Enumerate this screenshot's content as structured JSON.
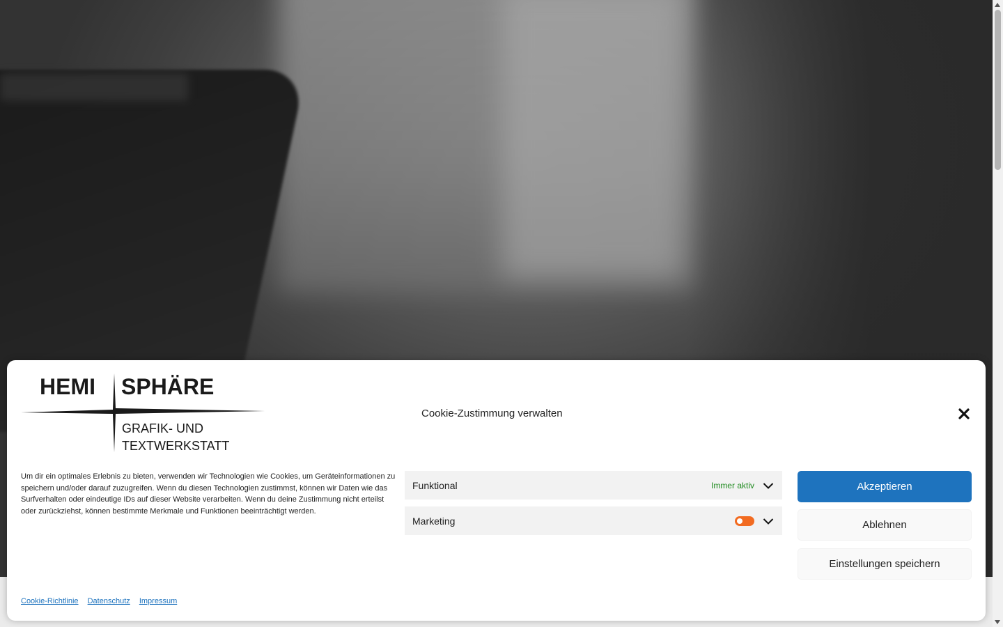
{
  "logo": {
    "line1_left": "HEMI",
    "line1_right": "SPHÄRE",
    "line2": "GRAFIK- UND",
    "line3": "TEXTWERKSTATT"
  },
  "banner": {
    "title": "Cookie-Zustimmung verwalten",
    "close_icon": "close-icon",
    "message": "Um dir ein optimales Erlebnis zu bieten, verwenden wir Technologien wie Cookies, um Geräteinformationen zu speichern und/oder darauf zuzugreifen. Wenn du diesen Technologien zustimmst, können wir Daten wie das Surfverhalten oder eindeutige IDs auf dieser Website verarbeiten. Wenn du deine Zustimmung nicht erteilst oder zurückziehst, können bestimmte Merkmale und Funktionen beeinträchtigt werden.",
    "categories": [
      {
        "name": "Funktional",
        "status": "Immer aktiv"
      },
      {
        "name": "Marketing",
        "toggle": "off"
      }
    ],
    "buttons": {
      "accept": "Akzeptieren",
      "deny": "Ablehnen",
      "save": "Einstellungen speichern"
    },
    "links": [
      "Cookie-Richtlinie",
      "Datenschutz",
      "Impressum"
    ]
  },
  "colors": {
    "accent": "#1e73be",
    "always_active": "#1e8a1e",
    "toggle": "#f26b21"
  }
}
